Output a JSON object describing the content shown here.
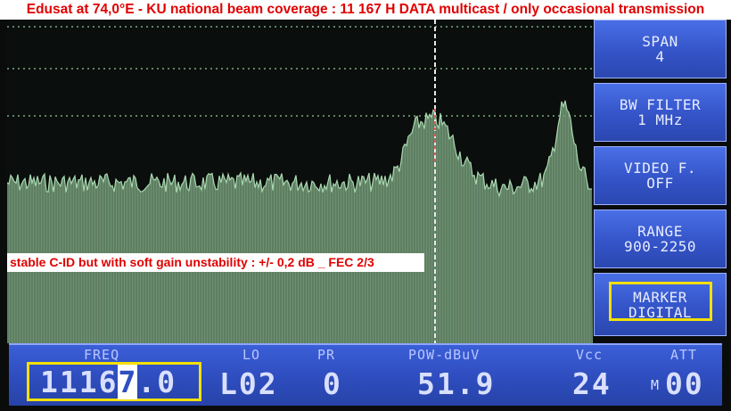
{
  "title": "Edusat at 74,0°E - KU national beam coverage : 11 167 H DATA multicast / only occasional transmission",
  "note": "stable C-ID but with soft gain unstability : +/- 0,2 dB _ FEC 2/3",
  "menu": {
    "span": {
      "line1": "SPAN",
      "line2": "4"
    },
    "bw_filter": {
      "line1": "BW FILTER",
      "line2": "1 MHz"
    },
    "video_filter": {
      "line1": "VIDEO F.",
      "line2": "OFF"
    },
    "range": {
      "line1": "RANGE",
      "line2": "900-2250"
    },
    "marker": {
      "line1": "MARKER",
      "line2": "DIGITAL"
    }
  },
  "status": {
    "freq_label": "FREQ",
    "freq_main": "1116",
    "freq_cursor": "7",
    "freq_tail": ".0",
    "lo_label": "LO",
    "lo_value": "L02",
    "pr_label": "PR",
    "pr_value": "0",
    "pow_label": "POW-dBuV",
    "pow_value": "51.9",
    "vcc_label": "Vcc",
    "vcc_value": "24",
    "att_label": "ATT",
    "att_prefix": "M",
    "att_value": "00"
  },
  "colors": {
    "trace": "#a8d8b0",
    "fill": "#7fa884",
    "grid": "#8fc49a",
    "marker_line": "#e8e8e8",
    "highlight": "#f4e000",
    "panel_blue": "#3454c8",
    "banner_text": "#e00000"
  }
}
